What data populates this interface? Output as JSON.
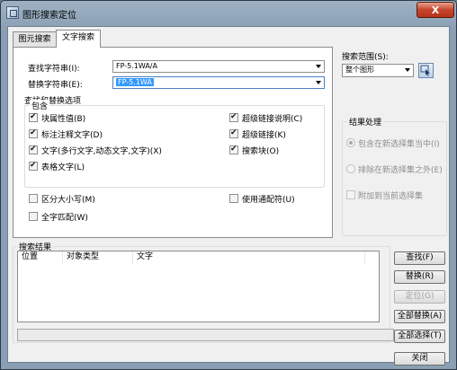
{
  "window": {
    "title": "图形搜索定位",
    "close_glyph": "X"
  },
  "tabs": [
    {
      "label": "图元搜索",
      "active": false
    },
    {
      "label": "文字搜索",
      "active": true
    }
  ],
  "find": {
    "label": "查找字符串(I):",
    "value": "FP-5.1WA/A"
  },
  "replace": {
    "label": "替换字符串(E):",
    "value": "FP-5.1WA"
  },
  "options": {
    "title": "查找和替换选项",
    "include_title": "包含",
    "left": [
      {
        "label": "块属性值(B)",
        "checked": true
      },
      {
        "label": "标注注释文字(D)",
        "checked": true
      },
      {
        "label": "文字(多行文字,动态文字,文字)(X)",
        "checked": true
      },
      {
        "label": "表格文字(L)",
        "checked": true
      }
    ],
    "right": [
      {
        "label": "超级链接说明(C)",
        "checked": true
      },
      {
        "label": "超级链接(K)",
        "checked": true
      },
      {
        "label": "搜索块(O)",
        "checked": true
      }
    ],
    "match_case": {
      "label": "区分大小写(M)",
      "checked": false
    },
    "whole_word": {
      "label": "全字匹配(W)",
      "checked": false
    },
    "wildcards": {
      "label": "使用通配符(U)",
      "checked": false
    }
  },
  "scope": {
    "label": "搜索范围(S):",
    "value": "整个图形"
  },
  "result_handling": {
    "title": "结果处理",
    "include_new": "包含在新选择集当中(I)",
    "exclude_new": "排除在新选择集之外(E)",
    "append": "附加到当前选择集"
  },
  "results": {
    "title": "搜索结果",
    "columns": [
      "位置",
      "对象类型",
      "文字"
    ]
  },
  "buttons": {
    "find": "查找(F)",
    "replace": "替换(R)",
    "locate": "定位(G)",
    "replace_all": "全部替换(A)",
    "select_all": "全部选择(T)",
    "close": "关闭"
  },
  "icons": {
    "app": "app-window-icon",
    "pick": "select-objects-icon"
  }
}
